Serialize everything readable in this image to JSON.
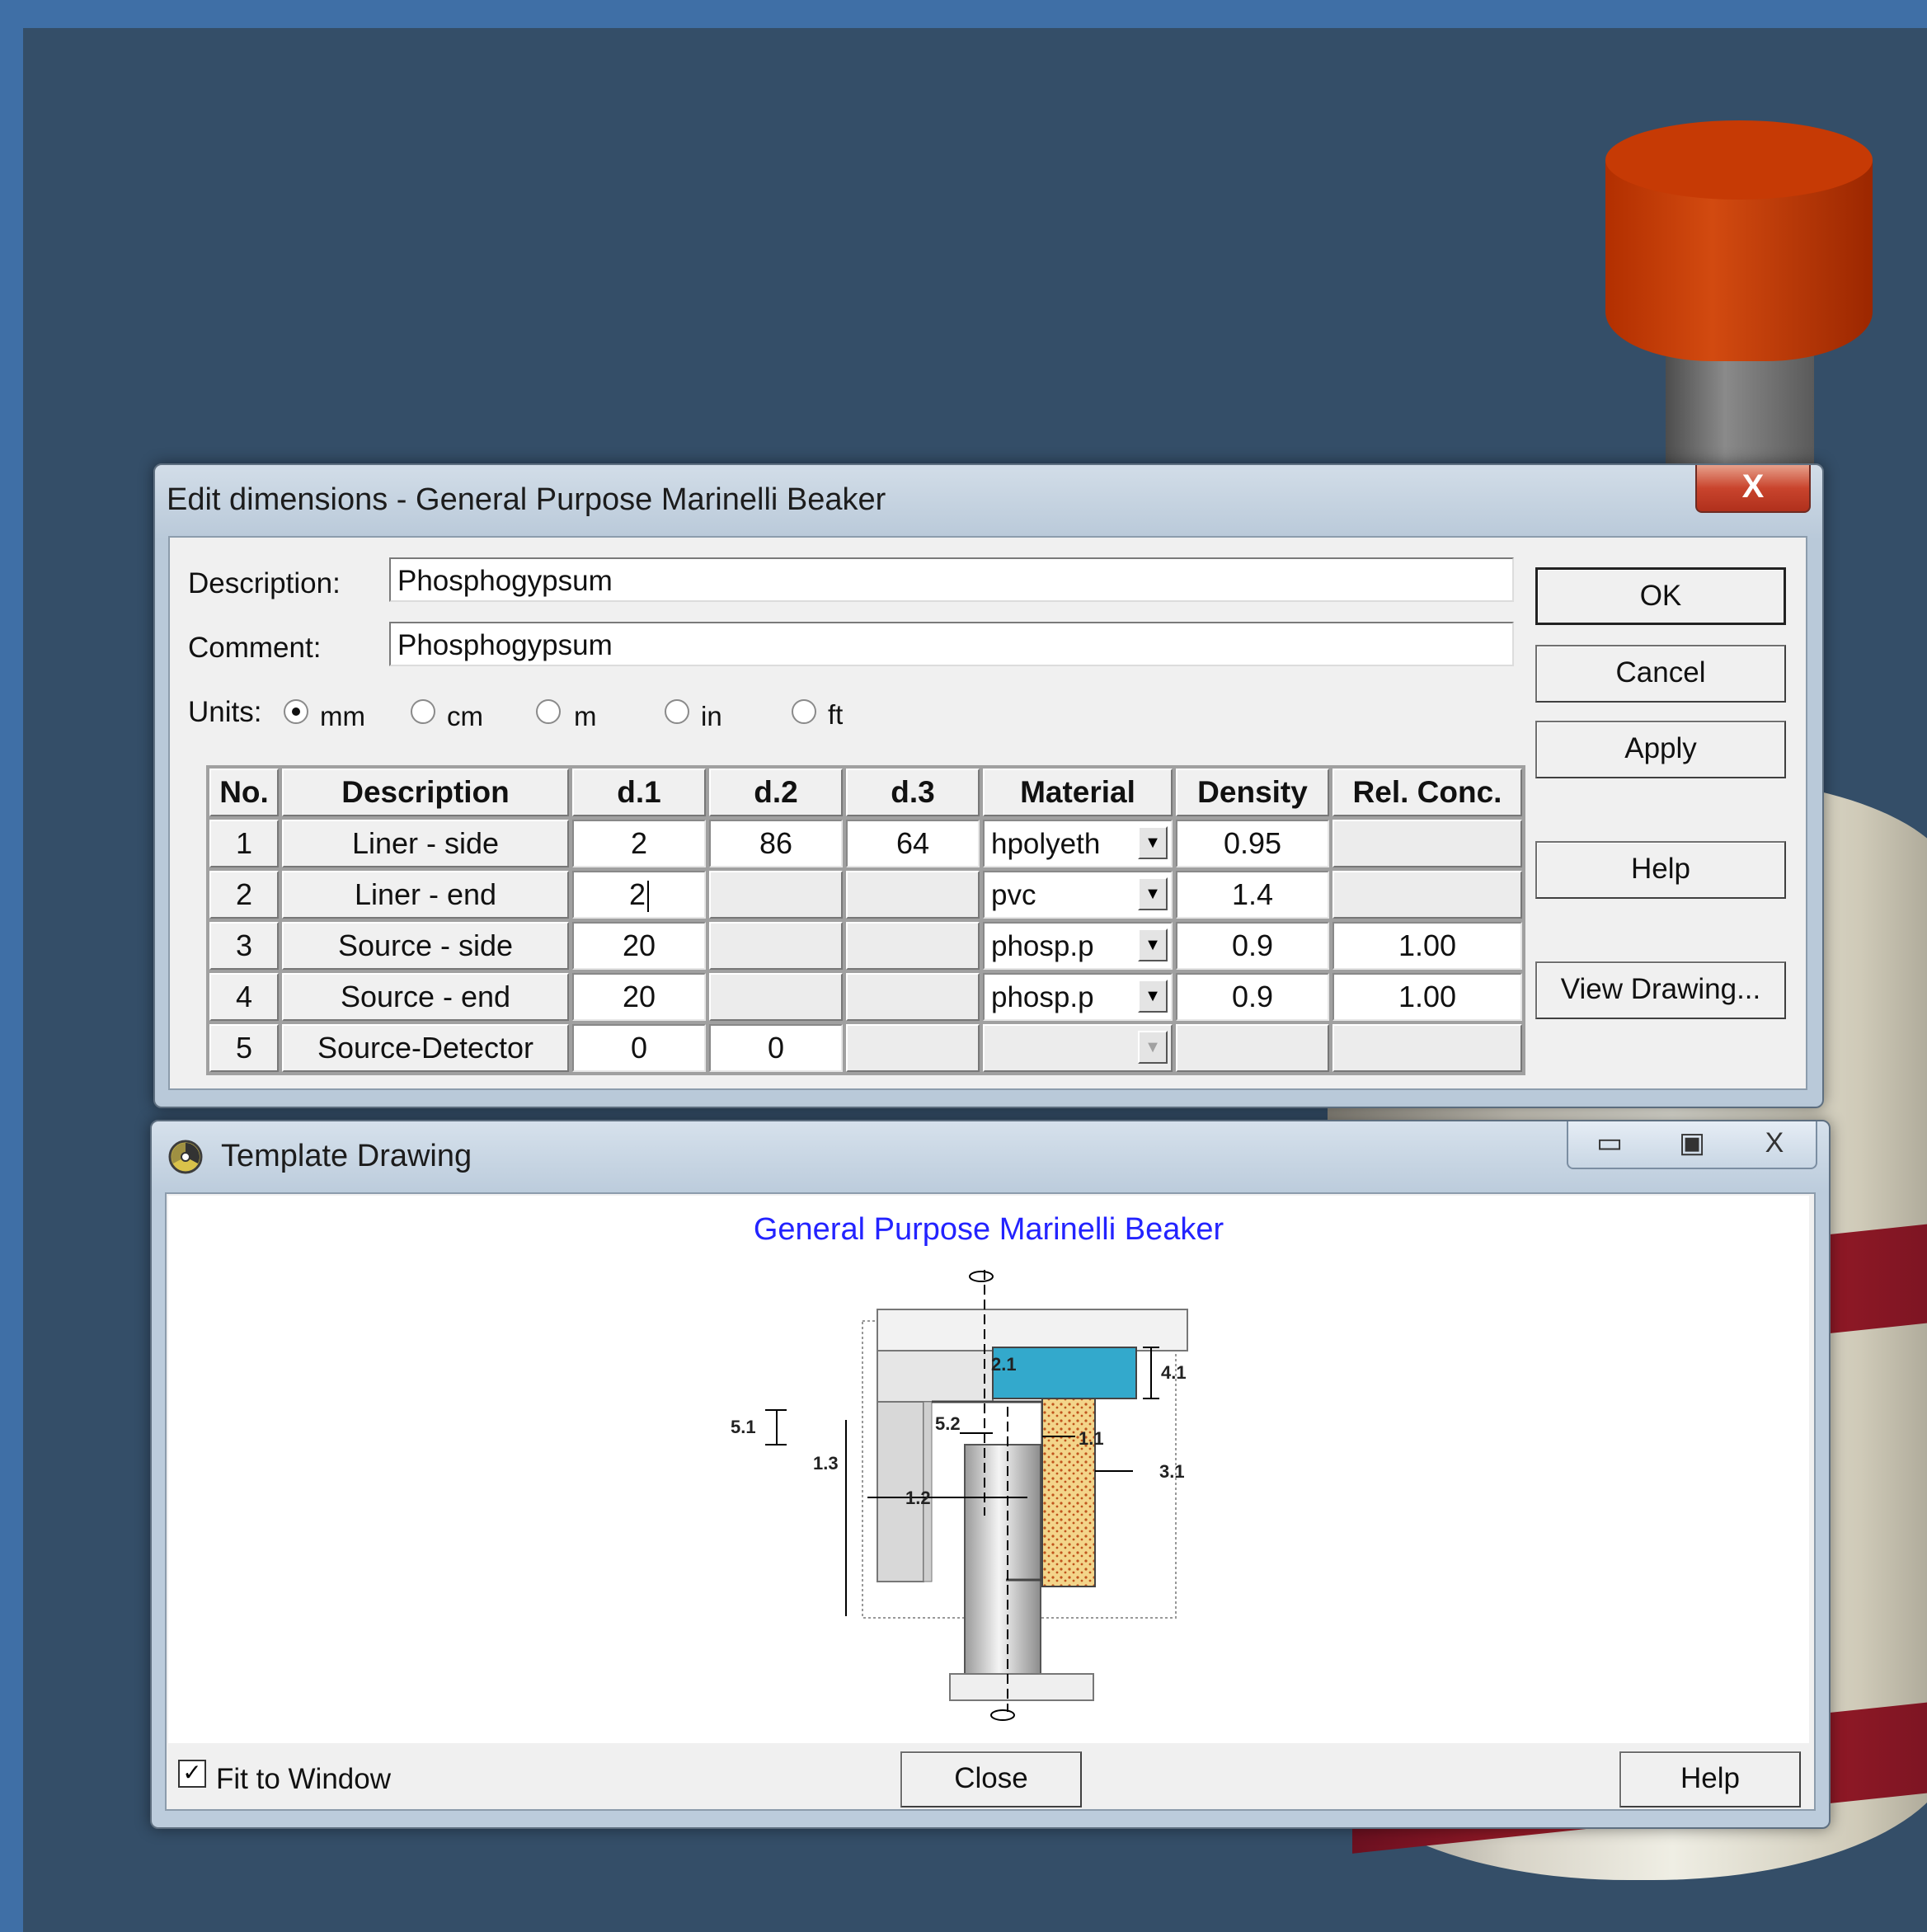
{
  "edit_dialog": {
    "title": "Edit dimensions - General Purpose Marinelli Beaker",
    "close_glyph": "X",
    "description_label": "Description:",
    "description_value": "Phosphogypsum",
    "comment_label": "Comment:",
    "comment_value": "Phosphogypsum",
    "units_label": "Units:",
    "units": [
      {
        "label": "mm",
        "selected": true
      },
      {
        "label": "cm",
        "selected": false
      },
      {
        "label": "m",
        "selected": false
      },
      {
        "label": "in",
        "selected": false
      },
      {
        "label": "ft",
        "selected": false
      }
    ],
    "buttons": {
      "ok": "OK",
      "cancel": "Cancel",
      "apply": "Apply",
      "help": "Help",
      "view_drawing": "View Drawing..."
    },
    "columns": [
      "No.",
      "Description",
      "d.1",
      "d.2",
      "d.3",
      "Material",
      "Density",
      "Rel. Conc."
    ],
    "rows": [
      {
        "no": "1",
        "description": "Liner - side",
        "d1": "2",
        "d2": "86",
        "d3": "64",
        "material": "hpolyeth",
        "density": "0.95",
        "rel_conc": ""
      },
      {
        "no": "2",
        "description": "Liner - end",
        "d1": "2",
        "d2": "",
        "d3": "",
        "material": "pvc",
        "density": "1.4",
        "rel_conc": ""
      },
      {
        "no": "3",
        "description": "Source - side",
        "d1": "20",
        "d2": "",
        "d3": "",
        "material": "phosp.p",
        "density": "0.9",
        "rel_conc": "1.00"
      },
      {
        "no": "4",
        "description": "Source - end",
        "d1": "20",
        "d2": "",
        "d3": "",
        "material": "phosp.p",
        "density": "0.9",
        "rel_conc": "1.00"
      },
      {
        "no": "5",
        "description": "Source-Detector",
        "d1": "0",
        "d2": "0",
        "d3": "",
        "material": "",
        "density": "",
        "rel_conc": ""
      }
    ]
  },
  "template_window": {
    "title": "Template Drawing",
    "controls": {
      "minimize": "▭",
      "restore": "▣",
      "close": "X"
    },
    "drawing_title": "General Purpose Marinelli Beaker",
    "dimension_labels": {
      "d21": "2.1",
      "d41": "4.1",
      "d51": "5.1",
      "d52": "5.2",
      "d11": "1.1",
      "d31": "3.1",
      "d13": "1.3",
      "d12": "1.2"
    },
    "fit_to_window_label": "Fit to Window",
    "fit_to_window_checked": true,
    "close_button": "Close",
    "help_button": "Help",
    "colors": {
      "source_end": "#33a9cc",
      "source_side": "#f3d58a",
      "title_blue": "#2323ff"
    }
  }
}
